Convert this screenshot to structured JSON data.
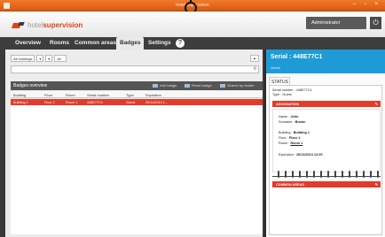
{
  "window": {
    "title": "hotel supervision"
  },
  "header": {
    "logo_part1": "hotel",
    "logo_part2": "supervision",
    "user": "Administrator"
  },
  "nav": {
    "tabs": [
      {
        "label": "Overview",
        "active": false
      },
      {
        "label": "Rooms",
        "active": false
      },
      {
        "label": "Common areas",
        "active": false
      },
      {
        "label": "Badges",
        "active": true
      },
      {
        "label": "Settings",
        "active": false
      }
    ],
    "help": "?"
  },
  "filters": {
    "buildings": "All buildings",
    "floors": "All"
  },
  "grid": {
    "title": "Badges overview",
    "actions": [
      "Add badge",
      "Reset badge",
      "Search by reader"
    ],
    "columns": [
      "Building",
      "Floor",
      "Room",
      "Serial number",
      "Type",
      "Expiration"
    ],
    "rows": [
      {
        "building": "Building 1",
        "floor": "Floor 1",
        "room": "Room 1",
        "serial": "448E77C1",
        "type": "Guest",
        "expiration": "20/11/2013 1..."
      }
    ]
  },
  "panel": {
    "serial_title": "Serial : 448E77C1",
    "kind": "Guest",
    "status_tab": "STATUS",
    "serial_line": "Serial number : 448E77C1",
    "type_line": "Type : Guest",
    "section_assignation": "ASSIGNATION",
    "name_label": "Name :",
    "name_value": "John",
    "surname_label": "Surname :",
    "surname_value": "Brown",
    "building_label": "Building :",
    "building_value": "Building 1",
    "floor_label": "Floor :",
    "floor_value": "Floor 1",
    "room_label": "Room :",
    "room_value": "Room 1",
    "expiration_label": "Expiration :",
    "expiration_value": "20/11/2013 12:00",
    "section_common": "COMMON AREAS"
  },
  "colors": {
    "accent_red": "#e43a2a",
    "accent_blue": "#1e9bd7",
    "titlebar_orange": "#e8691e"
  }
}
